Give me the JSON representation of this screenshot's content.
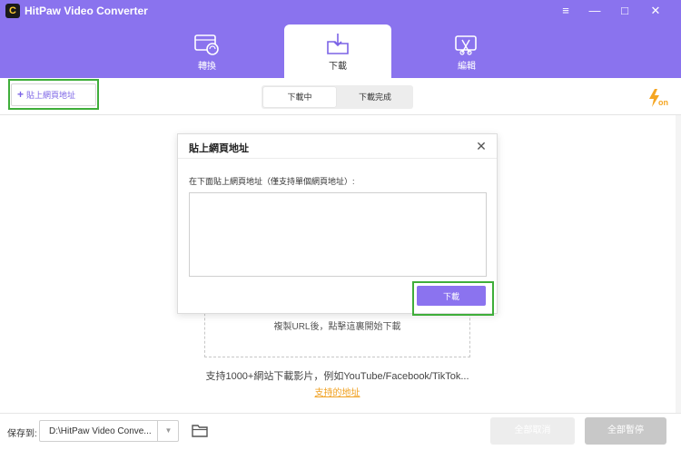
{
  "window": {
    "app_title": "HitPaw Video Converter",
    "logo_glyph": "C",
    "controls": {
      "menu": "≡",
      "minimize": "—",
      "maximize": "□",
      "close": "✕"
    }
  },
  "nav": {
    "tabs": [
      {
        "label": "轉換",
        "icon": "film-convert-icon"
      },
      {
        "label": "下載",
        "icon": "download-folder-icon",
        "active": true
      },
      {
        "label": "編輯",
        "icon": "edit-cut-icon"
      }
    ]
  },
  "toolbar": {
    "paste_label": "貼上網頁地址",
    "paste_plus": "+",
    "segments": {
      "downloading": "下載中",
      "completed": "下載完成"
    },
    "turbo_icon": "lightning-on-icon"
  },
  "dialog": {
    "title": "貼上網頁地址",
    "close": "✕",
    "hint": "在下面貼上網頁地址（僅支持單個網頁地址）:",
    "input_value": "",
    "download_label": "下載"
  },
  "main": {
    "drop_text": "複製URL後，點擊這裏開始下載",
    "support_text": "支持1000+網站下載影片，例如YouTube/Facebook/TikTok...",
    "support_link": "支持的地址"
  },
  "bottom": {
    "save_label": "保存到:",
    "path": "D:\\HitPaw Video Conve...",
    "dropdown_arrow": "▼",
    "convert_all": "全部取消",
    "pause_all": "全部暫停"
  },
  "colors": {
    "header": "#8a73ee",
    "accent": "#8b73ef",
    "highlight": "#3fae3a",
    "link": "#f0a020"
  }
}
